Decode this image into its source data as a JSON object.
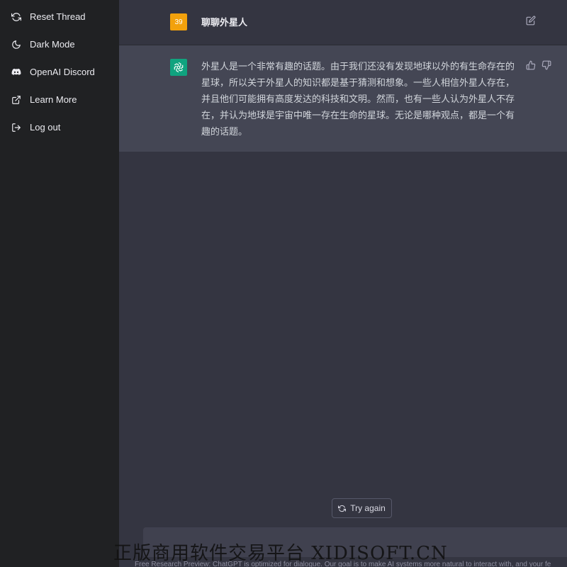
{
  "sidebar": {
    "items": [
      {
        "label": "Reset Thread",
        "icon": "refresh-icon"
      },
      {
        "label": "Dark Mode",
        "icon": "moon-icon"
      },
      {
        "label": "OpenAI Discord",
        "icon": "discord-icon"
      },
      {
        "label": "Learn More",
        "icon": "external-link-icon"
      },
      {
        "label": "Log out",
        "icon": "logout-icon"
      }
    ]
  },
  "conversation": {
    "user": {
      "avatar_text": "39",
      "message": "聊聊外星人"
    },
    "assistant": {
      "message": "外星人是一个非常有趣的话题。由于我们还没有发现地球以外的有生命存在的星球，所以关于外星人的知识都是基于猜测和想象。一些人相信外星人存在，并且他们可能拥有高度发达的科技和文明。然而，也有一些人认为外星人不存在，并认为地球是宇宙中唯一存在生命的星球。无论是哪种观点，都是一个有趣的话题。"
    }
  },
  "actions": {
    "try_again_label": "Try again"
  },
  "input": {
    "placeholder": ""
  },
  "footer": {
    "note": "Free Research Preview: ChatGPT is optimized for dialogue. Our goal is to make AI systems more natural to interact with, and your fe"
  },
  "watermark": {
    "text": "正版商用软件交易平台 XIDISOFT.CN"
  },
  "colors": {
    "sidebar_bg": "#202123",
    "main_bg": "#343541",
    "assistant_bg": "#444654",
    "user_avatar": "#f2a10c",
    "assistant_avatar": "#10a37f"
  }
}
